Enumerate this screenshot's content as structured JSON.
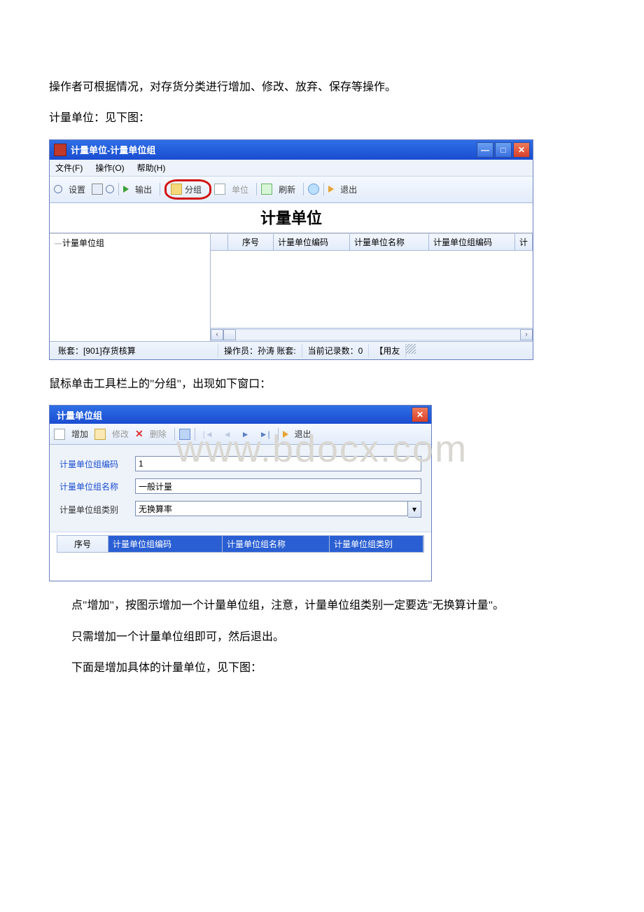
{
  "paragraphs": {
    "p1": "操作者可根据情况，对存货分类进行增加、修改、放弃、保存等操作。",
    "p2": "计量单位：见下图：",
    "p3": "鼠标单击工具栏上的\"分组\"，出现如下窗口：",
    "p4": "点\"增加\"，按图示增加一个计量单位组，注意，计量单位组类别一定要选\"无换算计量\"。",
    "p5": "只需增加一个计量单位组即可，然后退出。",
    "p6": "下面是增加具体的计量单位，见下图："
  },
  "watermark": "www.bdocx.com",
  "win1": {
    "title": "计量单位-计量单位组",
    "menu": {
      "file": "文件(F)",
      "operate": "操作(O)",
      "help": "帮助(H)"
    },
    "toolbar": {
      "settings": "设置",
      "output": "输出",
      "group": "分组",
      "unit": "单位",
      "refresh": "刷新",
      "exit": "退出"
    },
    "pagetitle": "计量单位",
    "tree_root": "计量单位组",
    "columns": {
      "seq": "序号",
      "code": "计量单位编码",
      "name": "计量单位名称",
      "groupcode": "计量单位组编码",
      "extra": "计"
    },
    "status": {
      "account": "账套：[901]存货核算",
      "operator": "操作员：孙涛  账套:",
      "records": "当前记录数：0",
      "brand": "【用友"
    }
  },
  "win2": {
    "title": "计量单位组",
    "toolbar": {
      "add": "增加",
      "edit": "修改",
      "delete": "删除",
      "exit": "退出"
    },
    "form": {
      "code_label": "计量单位组编码",
      "code_value": "1",
      "name_label": "计量单位组名称",
      "name_value": "一般计量",
      "type_label": "计量单位组类别",
      "type_value": "无换算率"
    },
    "columns": {
      "seq": "序号",
      "code": "计量单位组编码",
      "name": "计量单位组名称",
      "type": "计量单位组类别"
    }
  }
}
